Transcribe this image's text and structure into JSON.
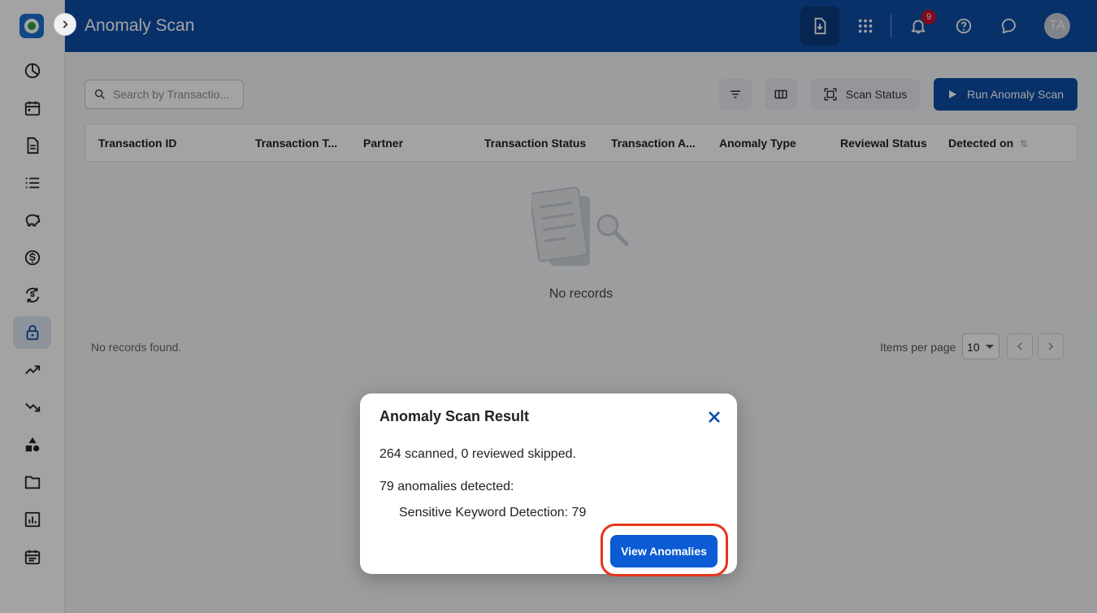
{
  "app": {
    "title": "Anomaly Scan",
    "brand_color": "#0d4ea6"
  },
  "sidebar": {
    "items": [
      {
        "icon": "dashboard-pie-icon"
      },
      {
        "icon": "calendar-icon"
      },
      {
        "icon": "document-icon"
      },
      {
        "icon": "list-icon"
      },
      {
        "icon": "piggy-bank-icon"
      },
      {
        "icon": "dollar-icon"
      },
      {
        "icon": "currency-exchange-icon"
      },
      {
        "icon": "lock-icon",
        "active": true
      },
      {
        "icon": "trending-up-icon"
      },
      {
        "icon": "trending-down-icon"
      },
      {
        "icon": "shapes-icon"
      },
      {
        "icon": "folder-icon"
      },
      {
        "icon": "bar-chart-icon"
      },
      {
        "icon": "event-calendar-icon"
      }
    ]
  },
  "header": {
    "notifications_count": "9",
    "user_initials": "TA"
  },
  "toolbar": {
    "search_placeholder": "Search by Transactio...",
    "scan_status_label": "Scan Status",
    "run_scan_label": "Run Anomaly Scan"
  },
  "table": {
    "columns": [
      "Transaction ID",
      "Transaction T...",
      "Partner",
      "Transaction Status",
      "Transaction A...",
      "Anomaly Type",
      "Reviewal Status",
      "Detected on"
    ],
    "empty_text": "No records"
  },
  "footer": {
    "no_records_found": "No records found.",
    "items_per_page_label": "Items per page",
    "items_per_page_value": "10"
  },
  "modal": {
    "title": "Anomaly Scan Result",
    "summary": "264 scanned, 0 reviewed skipped.",
    "anomalies_detected": "79 anomalies detected:",
    "detail": "Sensitive Keyword Detection: 79",
    "view_button": "View Anomalies"
  }
}
